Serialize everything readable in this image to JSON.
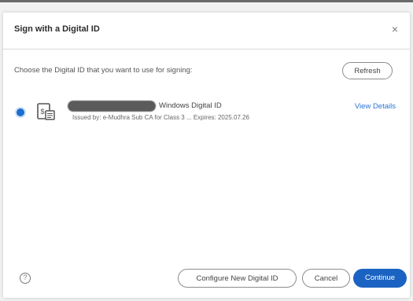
{
  "dialog": {
    "title": "Sign with a Digital ID",
    "close_glyph": "×",
    "prompt": "Choose the Digital ID that you want to use for signing:",
    "refresh_label": "Refresh"
  },
  "digital_ids": [
    {
      "selected": true,
      "icon": "certificate-icon",
      "type": "Windows Digital ID",
      "issuer_line": "Issued by: e-Mudhra Sub CA for Class 3 ... Expires: 2025.07.26",
      "view_details_label": "View Details"
    }
  ],
  "footer": {
    "help_glyph": "?",
    "configure_label": "Configure New Digital ID",
    "cancel_label": "Cancel",
    "continue_label": "Continue"
  },
  "colors": {
    "accent": "#1b63c2",
    "link": "#2a73d6"
  }
}
